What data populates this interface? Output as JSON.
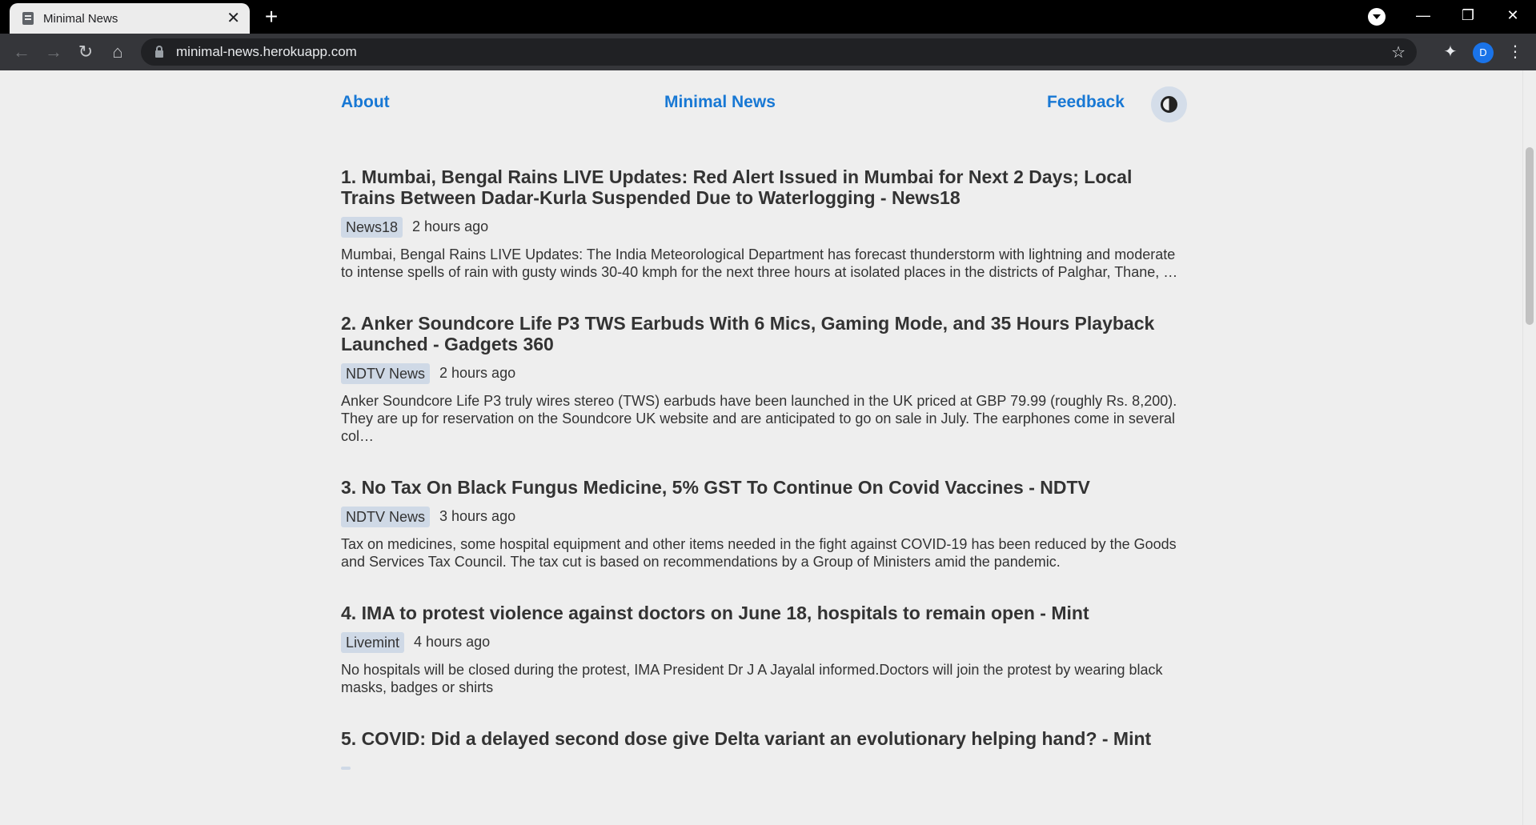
{
  "browser": {
    "tab_title": "Minimal News",
    "tab_close": "✕",
    "new_tab": "+",
    "url": "minimal-news.herokuapp.com",
    "profile_initial": "D",
    "icons": [
      "back-arrow-icon",
      "forward-arrow-icon",
      "reload-icon",
      "home-icon",
      "lock-icon",
      "star-icon",
      "extensions-icon",
      "kebab-menu-icon",
      "minimize-icon",
      "restore-icon",
      "close-icon"
    ]
  },
  "header": {
    "about": "About",
    "site_title": "Minimal News",
    "feedback": "Feedback"
  },
  "articles": [
    {
      "title": "1. Mumbai, Bengal Rains LIVE Updates: Red Alert Issued in Mumbai for Next 2 Days; Local Trains Between Dadar-Kurla Suspended Due to Waterlogging - News18",
      "source": "News18",
      "time": "2 hours ago",
      "description": "Mumbai, Bengal Rains LIVE Updates: The India Meteorological Department has forecast thunderstorm with lightning and moderate to intense spells of rain with gusty winds 30-40 kmph for the next three hours at isolated places in the districts of Palghar, Thane, …"
    },
    {
      "title": "2. Anker Soundcore Life P3 TWS Earbuds With 6 Mics, Gaming Mode, and 35 Hours Playback Launched - Gadgets 360",
      "source": "NDTV News",
      "time": "2 hours ago",
      "description": "Anker Soundcore Life P3 truly wires stereo (TWS) earbuds have been launched in the UK priced at GBP 79.99 (roughly Rs. 8,200). They are up for reservation on the Soundcore UK website and are anticipated to go on sale in July. The earphones come in several col…"
    },
    {
      "title": "3. No Tax On Black Fungus Medicine, 5% GST To Continue On Covid Vaccines - NDTV",
      "source": "NDTV News",
      "time": "3 hours ago",
      "description": "Tax on medicines, some hospital equipment and other items needed in the fight against COVID-19 has been reduced by the Goods and Services Tax Council. The tax cut is based on recommendations by a Group of Ministers amid the pandemic."
    },
    {
      "title": "4. IMA to protest violence against doctors on June 18, hospitals to remain open - Mint",
      "source": "Livemint",
      "time": "4 hours ago",
      "description": "No hospitals will be closed during the protest, IMA President Dr J A Jayalal informed.Doctors will join the protest by wearing black masks, badges or shirts"
    },
    {
      "title": "5. COVID: Did a delayed second dose give Delta variant an evolutionary helping hand? - Mint",
      "source": "",
      "time": "",
      "description": ""
    }
  ]
}
